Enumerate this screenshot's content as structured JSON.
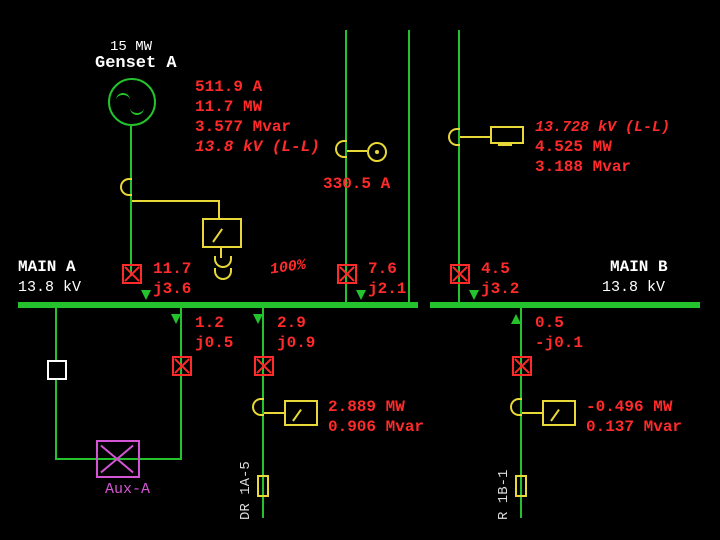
{
  "gensetA": {
    "rating": "15 MW",
    "name": "Genset A"
  },
  "gensetA_readings": {
    "amps": "511.9 A",
    "mw": "11.7 MW",
    "mvar": "3.577 Mvar",
    "kv": "13.8 kV (L-L)"
  },
  "ct_mid": {
    "amps": "330.5 A"
  },
  "meter_right": {
    "kv": "13.728 kV (L-L)",
    "mw": "4.525 MW",
    "mvar": "3.188 Mvar"
  },
  "busA": {
    "name": "MAIN A",
    "kv": "13.8 kV"
  },
  "busB": {
    "name": "MAIN B",
    "kv": "13.8 kV"
  },
  "flowA_in": {
    "p": "11.7",
    "q": "j3.6"
  },
  "xfmr_pct": "100%",
  "flow_mid_in": {
    "p": "7.6",
    "q": "j2.1"
  },
  "flow_right_in": {
    "p": "4.5",
    "q": "j3.2"
  },
  "feed_aux": {
    "p": "1.2",
    "q": "j0.5"
  },
  "feed_fdr1a5": {
    "p": "2.9",
    "q": "j0.9"
  },
  "feed_fdr1b1": {
    "p": "0.5",
    "q": "-j0.1"
  },
  "meter_fdr1a5": {
    "mw": "2.889 MW",
    "mvar": "0.906 Mvar"
  },
  "meter_fdr1b1": {
    "mw": "-0.496 MW",
    "mvar": "0.137 Mvar"
  },
  "aux": {
    "name": "Aux-A"
  },
  "fdr_labels": {
    "a": "DR 1A-5",
    "b": "R 1B-1"
  }
}
